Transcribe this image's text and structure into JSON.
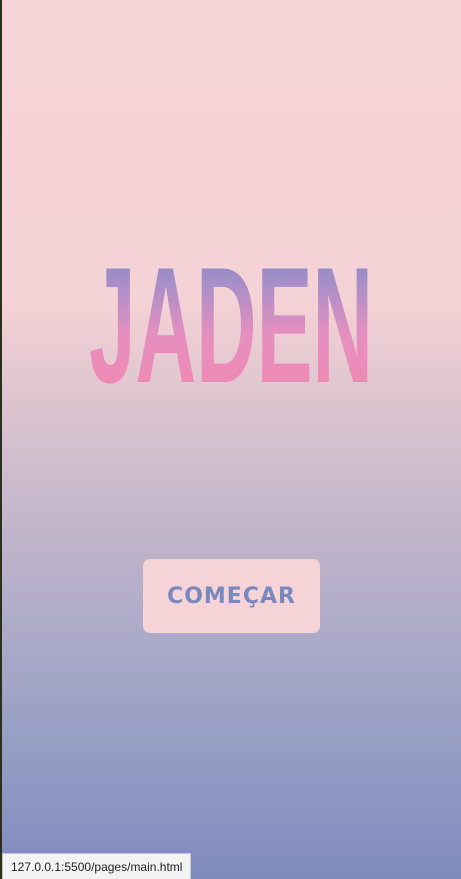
{
  "brand": {
    "title": "JADEN"
  },
  "actions": {
    "start_label": "COMEÇAR"
  },
  "status_bar": {
    "url": "127.0.0.1:5500/pages/main.html"
  },
  "colors": {
    "background_top": "#f6d3d6",
    "background_bottom": "#7f8bbd",
    "button_background": "#f6d3d7",
    "button_text": "#7a88c0",
    "logo_gradient_top": "#6f86c0",
    "logo_gradient_mid": "#e58fbf",
    "logo_gradient_bottom": "#7a5f86"
  }
}
